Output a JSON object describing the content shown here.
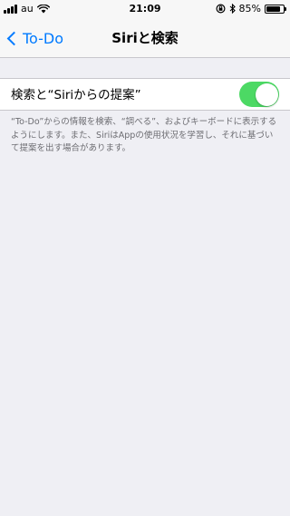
{
  "status_bar": {
    "carrier": "au",
    "time": "21:09",
    "battery_percent": "85%",
    "battery_level": 0.85,
    "icons": [
      "signal-icon",
      "wifi-icon",
      "rotation-lock-icon",
      "bluetooth-icon",
      "battery-icon"
    ]
  },
  "nav": {
    "back_label": "To-Do",
    "title": "Siriと検索"
  },
  "setting": {
    "label": "検索と“Siriからの提案”",
    "toggle_on": true
  },
  "footer": {
    "text": "“To-Do”からの情報を検索、“調べる”、およびキーボードに表示するようにします。また、SiriはAppの使用状況を学習し、それに基づいて提案を出す場合があります。"
  },
  "colors": {
    "accent": "#007aff",
    "toggle_on": "#4cd964",
    "background": "#efeff4"
  }
}
